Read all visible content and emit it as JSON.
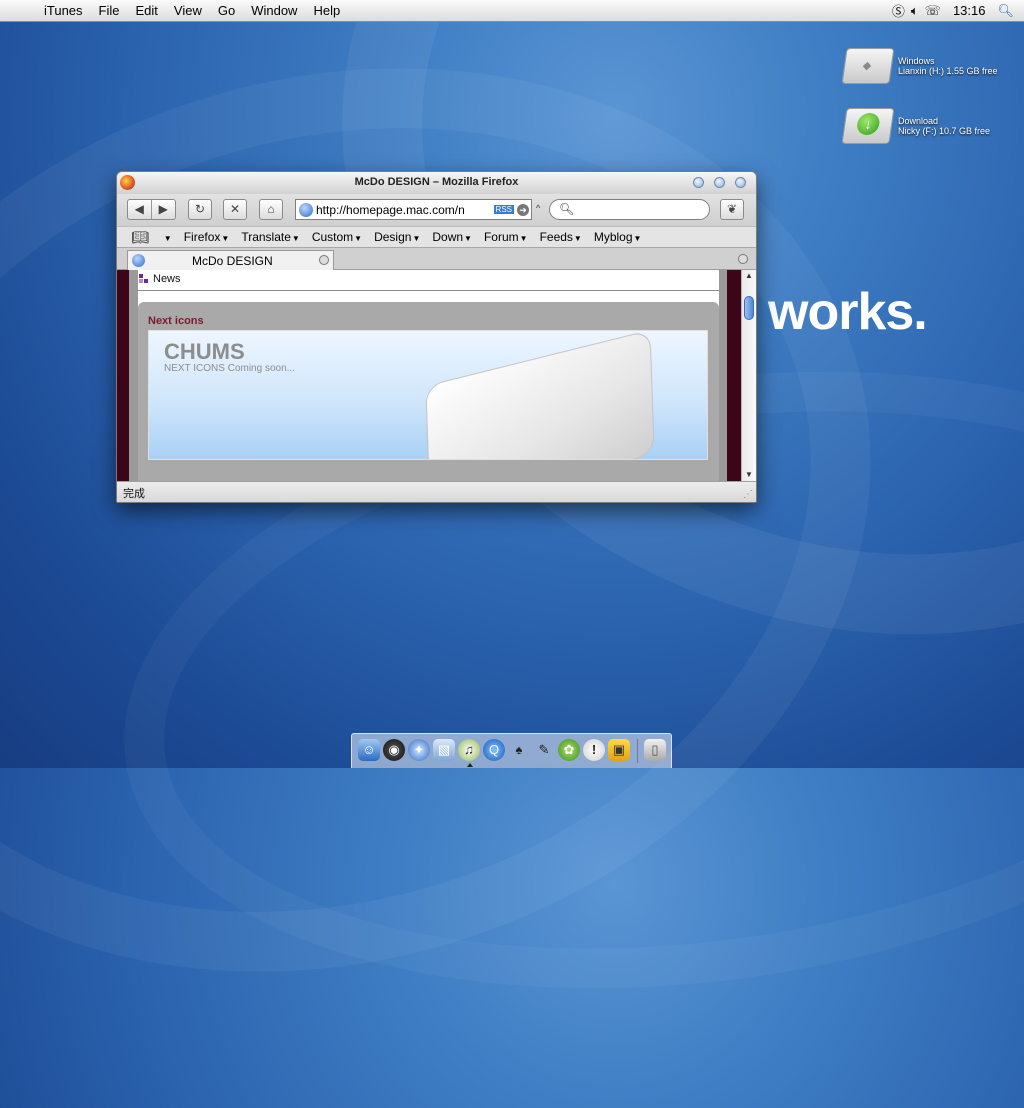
{
  "menubar": {
    "apple": "",
    "items": [
      "iTunes",
      "File",
      "Edit",
      "View",
      "Go",
      "Window",
      "Help"
    ],
    "clock": "13:16",
    "status_icons": [
      "skype-icon",
      "volume-icon",
      "phone-icon",
      "spotlight-icon"
    ]
  },
  "desktop": {
    "icons": [
      {
        "name": "Windows",
        "detail": "Lianxin (H:) 1.55 GB free"
      },
      {
        "name": "Download",
        "detail": "Nicky (F:) 10.7 GB free"
      }
    ],
    "wallpaper_text": "works."
  },
  "window": {
    "title": "McDo DESIGN – Mozilla Firefox",
    "url": "http://homepage.mac.com/n",
    "rss_badge": "RSS",
    "bookmarks": [
      "Firefox",
      "Translate",
      "Custom",
      "Design",
      "Down",
      "Forum",
      "Feeds",
      "Myblog"
    ],
    "tab_label": "McDo DESIGN",
    "status": "完成",
    "page": {
      "news_label": "News",
      "panel_title": "Next icons",
      "banner_title": "CHUMS",
      "banner_sub": "NEXT ICONS  Coming soon..."
    }
  },
  "dock": {
    "items": [
      "finder-icon",
      "dashboard-icon",
      "safari-icon",
      "preview-icon",
      "itunes-icon",
      "quicktime-icon",
      "mushroom-icon",
      "tools-icon",
      "adium-icon",
      "alert-icon",
      "bus-icon",
      "trash-icon"
    ]
  },
  "colors": {
    "accent_blue": "#3a78c8",
    "page_bar": "#3c0618",
    "panel_title": "#7a1c2b"
  }
}
